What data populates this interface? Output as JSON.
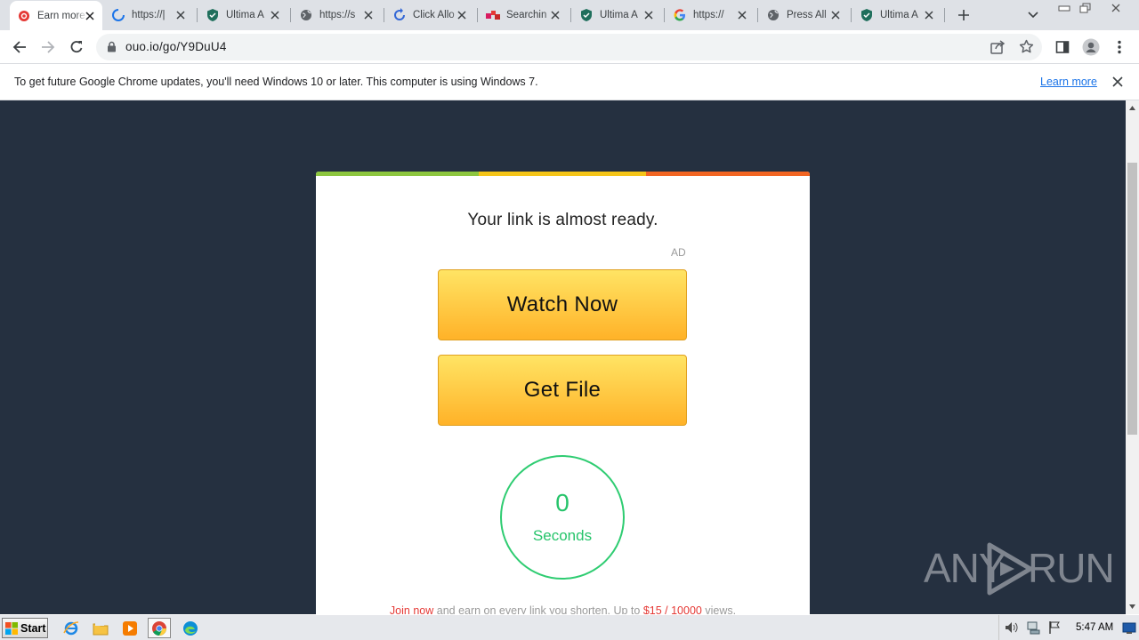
{
  "browser": {
    "tabs": [
      {
        "title": "Earn more",
        "favicon": "red-circle-icon",
        "active": true
      },
      {
        "title": "https://|",
        "favicon": "loading-spinner-icon",
        "active": false
      },
      {
        "title": "Ultima A",
        "favicon": "shield-icon",
        "active": false
      },
      {
        "title": "https://s",
        "favicon": "globe-icon",
        "active": false
      },
      {
        "title": "Click Allo",
        "favicon": "refresh-icon",
        "active": false
      },
      {
        "title": "Searchin",
        "favicon": "colored-squares-icon",
        "active": false
      },
      {
        "title": "Ultima A",
        "favicon": "shield-icon",
        "active": false
      },
      {
        "title": "https://",
        "favicon": "google-icon",
        "active": false
      },
      {
        "title": "Press All",
        "favicon": "globe-icon",
        "active": false
      },
      {
        "title": "Ultima A",
        "favicon": "shield-icon",
        "active": false
      }
    ],
    "url": "ouo.io/go/Y9DuU4",
    "infobar": {
      "message": "To get future Google Chrome updates, you'll need Windows 10 or later. This computer is using Windows 7.",
      "link": "Learn more"
    }
  },
  "page": {
    "heading": "Your link is almost ready.",
    "ad_label": "AD",
    "watch_button": "Watch Now",
    "get_file_button": "Get File",
    "timer": {
      "value": "0",
      "label": "Seconds"
    },
    "footer": {
      "join": "Join now",
      "text1": " and earn on every link you shorten. Up to ",
      "rate": "$15 / 10000",
      "text2": " views."
    },
    "top_bar_colors": [
      "#8dc63f",
      "#f5c518",
      "#f26522"
    ],
    "accent_green": "#2ecc71"
  },
  "watermark": {
    "left": "ANY",
    "right": "RUN"
  },
  "taskbar": {
    "start_label": "Start",
    "clock": "5:47 AM",
    "apps": [
      "internet-explorer-icon",
      "folder-icon",
      "media-player-icon",
      "chrome-icon",
      "edge-icon"
    ]
  }
}
